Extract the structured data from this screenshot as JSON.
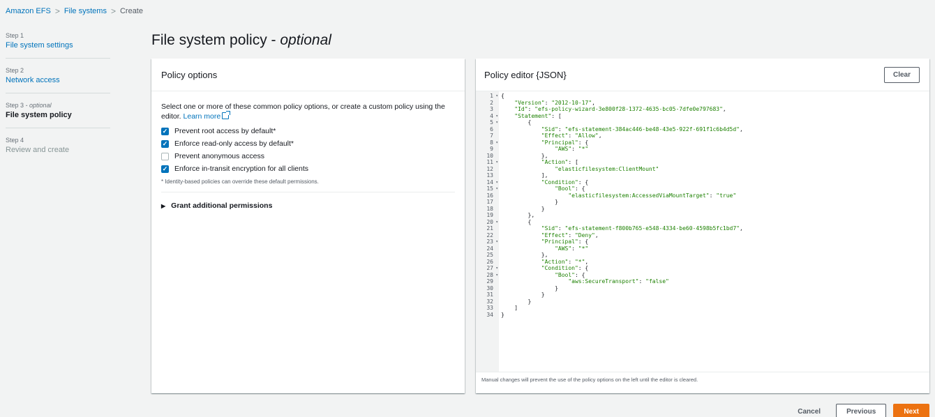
{
  "breadcrumb": [
    "Amazon EFS",
    "File systems",
    "Create"
  ],
  "steps": [
    {
      "num": "Step 1",
      "label": "File system settings"
    },
    {
      "num": "Step 2",
      "label": "Network access"
    },
    {
      "num": "Step 3",
      "num_suffix": "- optional",
      "label": "File system policy"
    },
    {
      "num": "Step 4",
      "label": "Review and create"
    }
  ],
  "title": {
    "main": "File system policy - ",
    "suffix": "optional"
  },
  "policy_options": {
    "header": "Policy options",
    "description": "Select one or more of these common policy options, or create a custom policy using the editor. ",
    "learn_more": "Learn more",
    "options": [
      {
        "label": "Prevent root access by default*",
        "checked": true
      },
      {
        "label": "Enforce read-only access by default*",
        "checked": true
      },
      {
        "label": "Prevent anonymous access",
        "checked": false
      },
      {
        "label": "Enforce in-transit encryption for all clients",
        "checked": true
      }
    ],
    "footnote": "* Identity-based policies can override these default permissions.",
    "grant": "Grant additional permissions"
  },
  "editor": {
    "header": "Policy editor {JSON}",
    "clear": "Clear",
    "note": "Manual changes will prevent the use of the policy options on the left until the editor is cleared.",
    "lines": [
      "{",
      "    \"Version\": \"2012-10-17\",",
      "    \"Id\": \"efs-policy-wizard-3e800f28-1372-4635-bc05-7dfe0e797683\",",
      "    \"Statement\": [",
      "        {",
      "            \"Sid\": \"efs-statement-384ac446-be48-43e5-922f-691f1c6b4d5d\",",
      "            \"Effect\": \"Allow\",",
      "            \"Principal\": {",
      "                \"AWS\": \"*\"",
      "            },",
      "            \"Action\": [",
      "                \"elasticfilesystem:ClientMount\"",
      "            ],",
      "            \"Condition\": {",
      "                \"Bool\": {",
      "                    \"elasticfilesystem:AccessedViaMountTarget\": \"true\"",
      "                }",
      "            }",
      "        },",
      "        {",
      "            \"Sid\": \"efs-statement-f800b765-e548-4334-be60-4598b5fc1bd7\",",
      "            \"Effect\": \"Deny\",",
      "            \"Principal\": {",
      "                \"AWS\": \"*\"",
      "            },",
      "            \"Action\": \"*\",",
      "            \"Condition\": {",
      "                \"Bool\": {",
      "                    \"aws:SecureTransport\": \"false\"",
      "                }",
      "            }",
      "        }",
      "    ]",
      "}"
    ],
    "fold_lines": [
      1,
      4,
      5,
      8,
      11,
      14,
      15,
      20,
      23,
      27,
      28
    ]
  },
  "footer": {
    "cancel": "Cancel",
    "previous": "Previous",
    "next": "Next"
  }
}
